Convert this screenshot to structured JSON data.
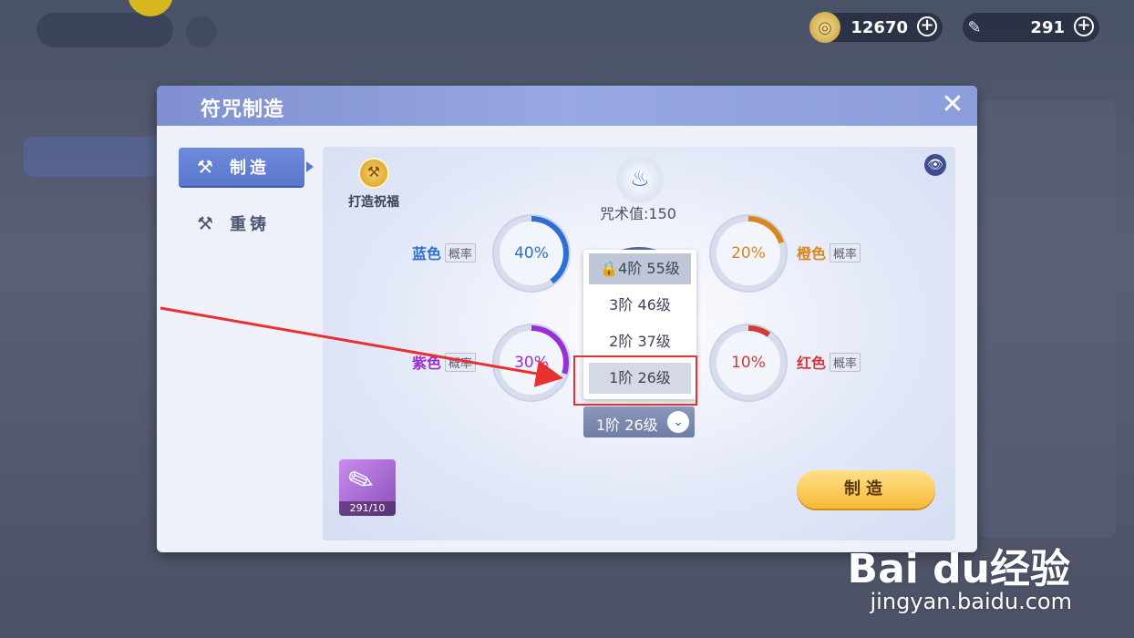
{
  "resources": {
    "coins": {
      "value": "12670"
    },
    "brushes": {
      "value": "291"
    }
  },
  "modal": {
    "title": "符咒制造",
    "close_label": "✕"
  },
  "tabs": [
    {
      "label": "制造"
    },
    {
      "label": "重铸"
    }
  ],
  "blessing": {
    "label": "打造祝福"
  },
  "spell_value": "咒术值:150",
  "probabilities": {
    "blue": {
      "name": "蓝色",
      "tag": "概率",
      "pct": "40%",
      "fraction": 0.4,
      "color": "#2e6fcf"
    },
    "orange": {
      "name": "橙色",
      "tag": "概率",
      "pct": "20%",
      "fraction": 0.2,
      "color": "#d9861c"
    },
    "purple": {
      "name": "紫色",
      "tag": "概率",
      "pct": "30%",
      "fraction": 0.3,
      "color": "#9b2fd6"
    },
    "red": {
      "name": "红色",
      "tag": "概率",
      "pct": "10%",
      "fraction": 0.1,
      "color": "#d23a3a"
    }
  },
  "tier_dropdown": {
    "options": [
      "4阶 55级",
      "3阶 46级",
      "2阶 37级",
      "1阶 26级"
    ],
    "selected": "1阶 26级"
  },
  "material": {
    "count": "291/10"
  },
  "make_button": "制造",
  "watermark": {
    "brand": "Bai du经验",
    "url": "jingyan.baidu.com"
  }
}
